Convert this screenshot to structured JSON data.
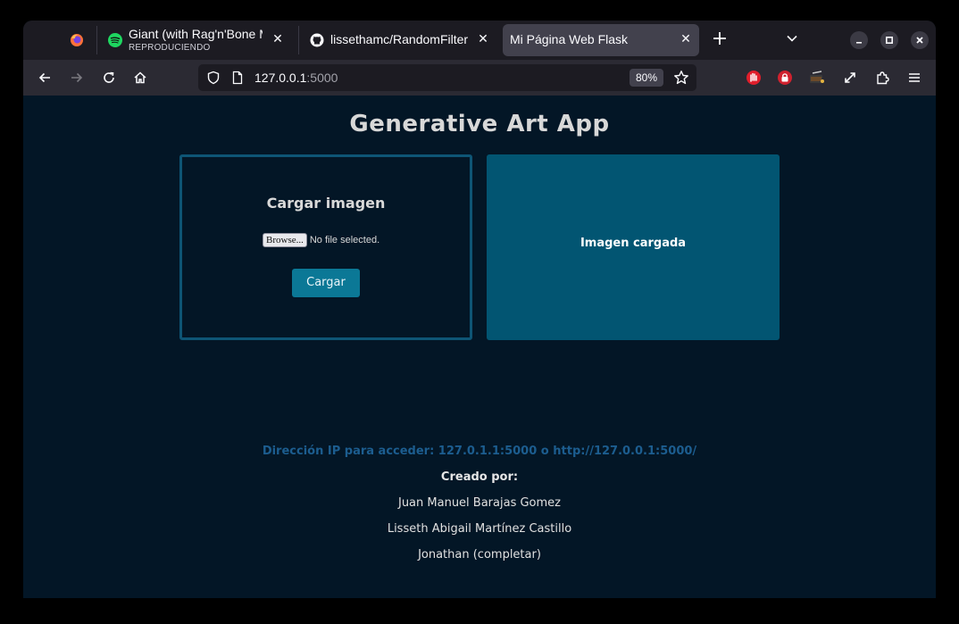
{
  "browser": {
    "tabs": [
      {
        "title": "Giant (with Rag'n'Bone Man)",
        "subtitle": "REPRODUCIENDO",
        "icon": "spotify-icon",
        "active": false
      },
      {
        "title": "lissethamc/RandomFilter",
        "icon": "github-icon",
        "active": false
      },
      {
        "title": "Mi Página Web Flask",
        "icon": "",
        "active": true
      }
    ],
    "new_tab": "+",
    "url": {
      "host": "127.0.0.1",
      "port": ":5000"
    },
    "zoom": "80%"
  },
  "page": {
    "title": "Generative Art App",
    "upload": {
      "heading": "Cargar imagen",
      "browse_label": "Browse...",
      "file_status": "No file selected.",
      "submit_label": "Cargar"
    },
    "preview": {
      "label": "Imagen cargada"
    },
    "footer": {
      "ip_line": "Dirección IP para acceder: 127.0.1.1:5000 o http://127.0.0.1:5000/",
      "created_by": "Creado por:",
      "authors": [
        "Juan Manuel Barajas Gomez",
        "Lisseth Abigail Martínez Castillo",
        "Jonathan (completar)"
      ]
    }
  },
  "colors": {
    "page_bg": "#031626",
    "accent": "#0b7896",
    "preview_bg": "#025572",
    "border": "#0e5575"
  }
}
